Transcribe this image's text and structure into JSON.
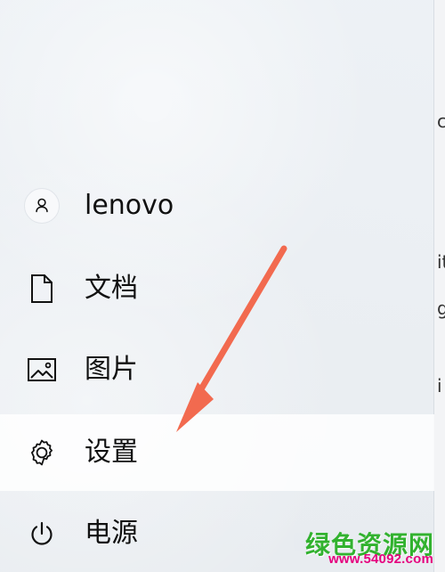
{
  "menu": {
    "items": [
      {
        "label": "lenovo",
        "icon": "user-icon"
      },
      {
        "label": "文档",
        "icon": "document-icon"
      },
      {
        "label": "图片",
        "icon": "picture-icon"
      },
      {
        "label": "设置",
        "icon": "gear-icon",
        "active": true
      },
      {
        "label": "电源",
        "icon": "power-icon"
      }
    ]
  },
  "annotation": {
    "arrow_color": "#f26a4f"
  },
  "watermark": {
    "site_name": "绿色资源网",
    "url": "www.54092.com",
    "green": "#32b22f",
    "pink": "#e5007e"
  }
}
